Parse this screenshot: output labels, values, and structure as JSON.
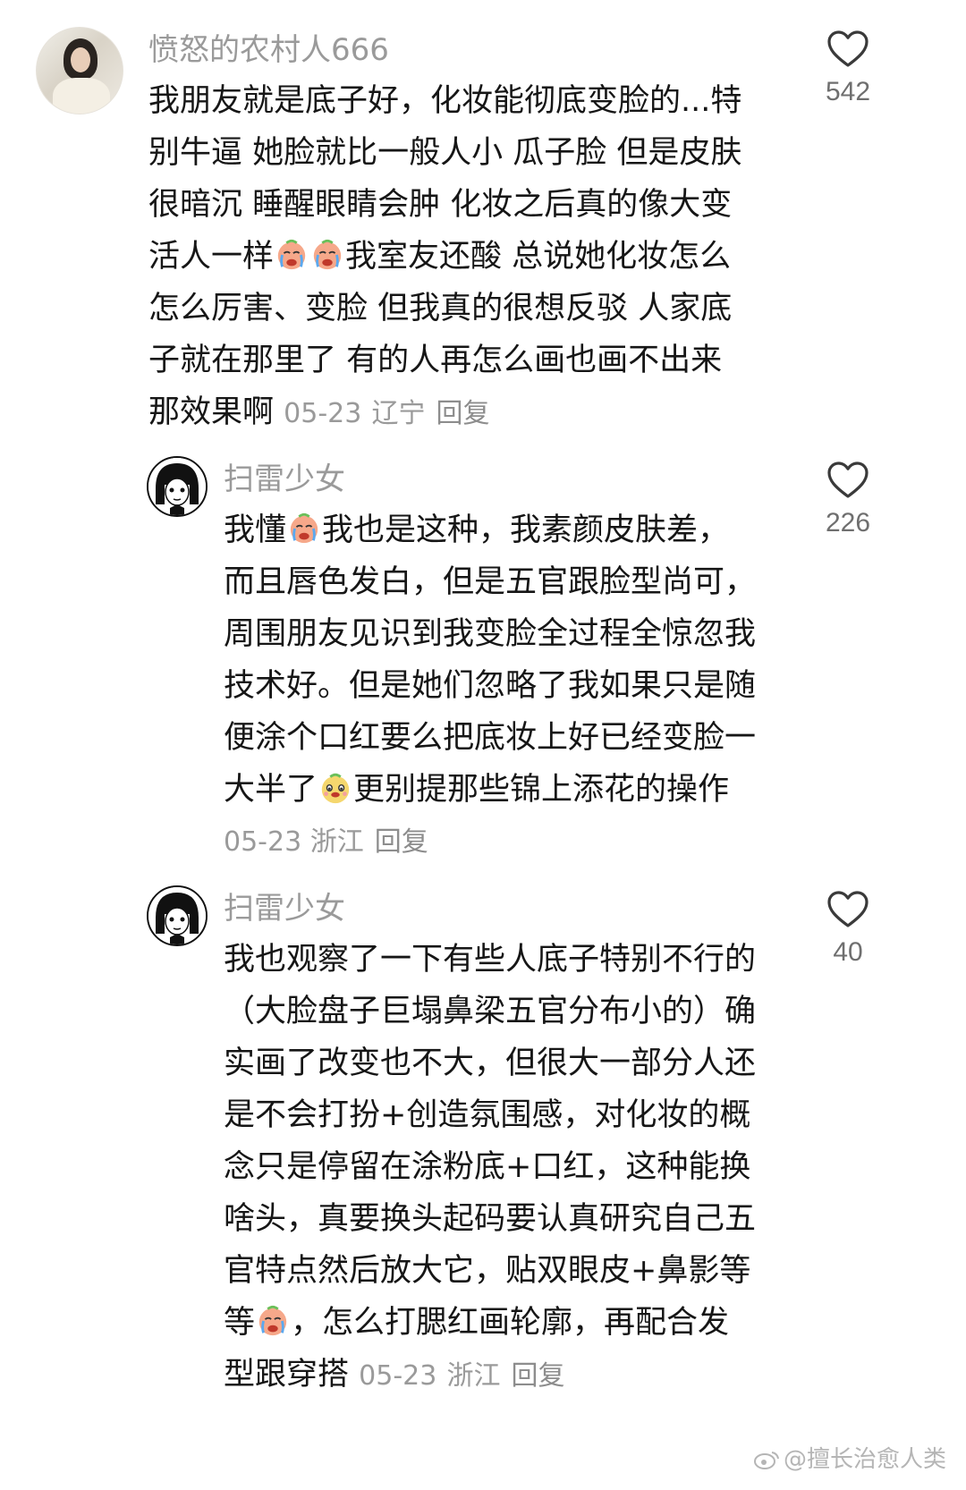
{
  "comments": [
    {
      "username": "愤怒的农村人666",
      "avatar": "avatar-photo-woman",
      "lines": [
        "我朋友就是底子好，化妆能彻底变脸的...特",
        "别牛逼 她脸就比一般人小 瓜子脸 但是皮肤",
        "很暗沉 睡醒眼睛会肿 化妆之后真的像大变",
        "活人一样",
        "我室友还酸 总说她化妆怎么",
        "怎么厉害、变脸 但我真的很想反驳 人家底",
        "子就在那里了 有的人再怎么画也画不出来",
        "那效果啊"
      ],
      "date": "05-23",
      "location": "辽宁",
      "reply": "回复",
      "likes": "542"
    },
    {
      "username": "扫雷少女",
      "avatar": "avatar-comic-girl",
      "lines": [
        "我懂",
        "我也是这种，我素颜皮肤差，",
        "而且唇色发白，但是五官跟脸型尚可，",
        "周围朋友见识到我变脸全过程全惊忽我",
        "技术好。但是她们忽略了我如果只是随",
        "便涂个口红要么把底妆上好已经变脸一",
        "大半了",
        "更别提那些锦上添花的操作"
      ],
      "date": "05-23",
      "location": "浙江",
      "reply": "回复",
      "likes": "226"
    },
    {
      "username": "扫雷少女",
      "avatar": "avatar-comic-girl",
      "lines": [
        "我也观察了一下有些人底子特别不行的",
        "（大脸盘子巨塌鼻梁五官分布小的）确",
        "实画了改变也不大，但很大一部分人还",
        "是不会打扮+创造氛围感，对化妆的概",
        "念只是停留在涂粉底+口红，这种能换",
        "啥头，真要换头起码要认真研究自己五",
        "官特点然后放大它，贴双眼皮+鼻影等",
        "等",
        "，怎么打腮红画轮廓，再配合发",
        "型跟穿搭"
      ],
      "date": "05-23",
      "location": "浙江",
      "reply": "回复",
      "likes": "40"
    }
  ],
  "emojis": {
    "crying": "crying-emoji-icon",
    "smug": "smug-emoji-icon"
  },
  "colors": {
    "text": "#161616",
    "meta": "#9a9a9a",
    "heart_stroke": "#3a3a3a",
    "background": "#ffffff"
  },
  "watermark": "@擅长治愈人类"
}
